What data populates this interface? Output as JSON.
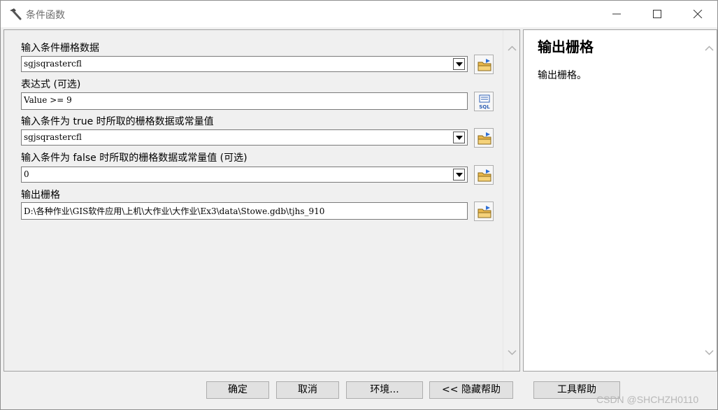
{
  "window": {
    "title": "条件函数",
    "title_icon": "hammer-icon"
  },
  "form": {
    "fields": [
      {
        "label": "输入条件栅格数据",
        "value": "sgjsqrastercfl",
        "control": "combo",
        "button_icon": "folder-open-icon"
      },
      {
        "label": "表达式 (可选)",
        "value": "Value >= 9",
        "control": "text",
        "button_icon": "sql-icon"
      },
      {
        "label": "输入条件为 true 时所取的栅格数据或常量值",
        "value": "sgjsqrastercfl",
        "control": "combo",
        "button_icon": "folder-open-icon"
      },
      {
        "label": "输入条件为 false 时所取的栅格数据或常量值 (可选)",
        "value": "0",
        "control": "combo",
        "button_icon": "folder-open-icon"
      },
      {
        "label": "输出栅格",
        "value": "D:\\各种作业\\GIS软件应用\\上机\\大作业\\大作业\\Ex3\\data\\Stowe.gdb\\tjhs_910",
        "control": "text",
        "button_icon": "folder-open-icon"
      }
    ]
  },
  "help": {
    "title": "输出栅格",
    "body": "输出栅格。"
  },
  "buttons": {
    "ok": "确定",
    "cancel": "取消",
    "env": "环境...",
    "hide_help": "<< 隐藏帮助",
    "tool_help": "工具帮助"
  },
  "watermark": "CSDN @SHCHZH0110",
  "colors": {
    "folder": "#f0c040",
    "folder_arrow": "#2e6fd6",
    "sql": "#2d5fb5"
  }
}
